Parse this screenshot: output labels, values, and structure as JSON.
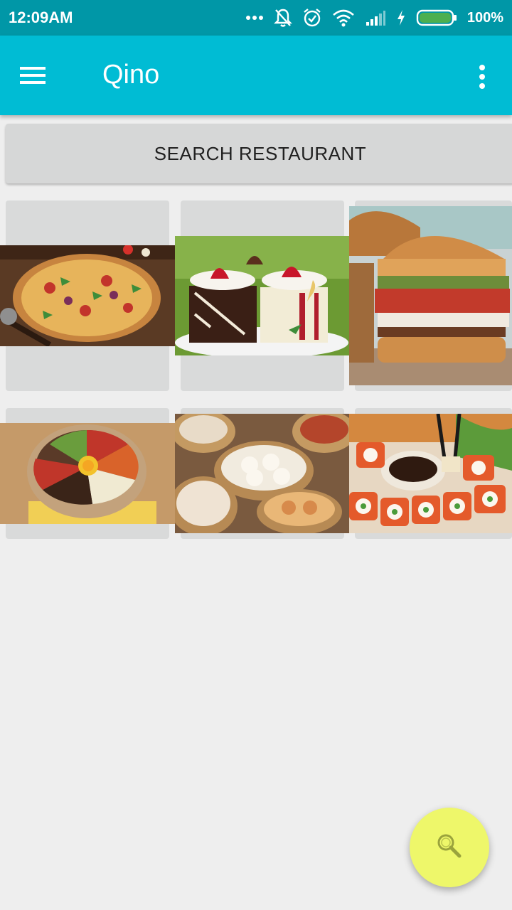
{
  "status_bar": {
    "time": "12:09AM",
    "battery_percent": "100%",
    "icons": [
      "more-dots-icon",
      "notifications-off-icon",
      "alarm-icon",
      "wifi-icon",
      "signal-icon",
      "charging-icon",
      "battery-icon"
    ]
  },
  "app_bar": {
    "title": "Qino",
    "menu_icon": "hamburger-menu-icon",
    "overflow_icon": "more-vert-icon",
    "color": "#00bcd4"
  },
  "search_button": {
    "label": "SEARCH RESTAURANT"
  },
  "categories": [
    {
      "image": "pizza"
    },
    {
      "image": "cake"
    },
    {
      "image": "burger"
    },
    {
      "image": "bibimbap"
    },
    {
      "image": "dim-sum"
    },
    {
      "image": "sushi"
    }
  ],
  "fab": {
    "icon": "search-icon",
    "color": "#eef76a"
  }
}
